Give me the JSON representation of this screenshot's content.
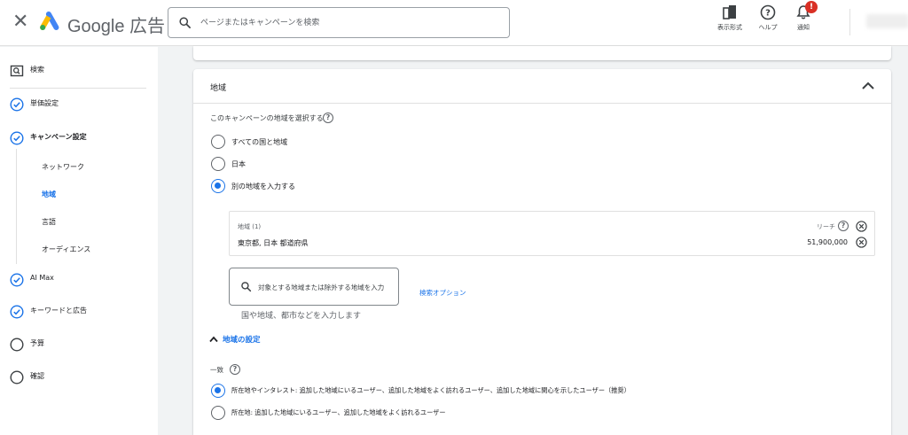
{
  "header": {
    "brand": "Google 広告",
    "search_placeholder": "ページまたはキャンペーンを検索",
    "tools": [
      {
        "label": "表示形式",
        "icon": "display-format-icon"
      },
      {
        "label": "ヘルプ",
        "icon": "help-icon"
      },
      {
        "label": "通知",
        "icon": "bell-icon",
        "badge": "!"
      }
    ]
  },
  "sidebar": {
    "search_label": "検索",
    "items": [
      {
        "label": "単価設定",
        "status": "done"
      },
      {
        "label": "キャンペーン設定",
        "status": "done"
      },
      {
        "label": "AI Max",
        "status": "done"
      },
      {
        "label": "キーワードと広告",
        "status": "done"
      },
      {
        "label": "予算",
        "status": "todo"
      },
      {
        "label": "確認",
        "status": "todo"
      }
    ],
    "subitems": [
      {
        "label": "ネットワーク"
      },
      {
        "label": "地域",
        "active": true
      },
      {
        "label": "言語"
      },
      {
        "label": "オーディエンス"
      }
    ]
  },
  "section": {
    "title": "地域",
    "question": "このキャンペーンの地域を選択する",
    "options": [
      {
        "label": "すべての国と地域",
        "selected": false
      },
      {
        "label": "日本",
        "selected": false
      },
      {
        "label": "別の地域を入力する",
        "selected": true
      }
    ],
    "locations_header": "地域 (1)",
    "reach_label": "リーチ",
    "location_name": "東京都, 日本 都道府県",
    "location_reach": "51,900,000",
    "input_placeholder": "対象とする地域または除外する地域を入力",
    "search_options": "検索オプション",
    "hint": "国や地域、都市などを入力します",
    "settings_label": "地域の設定",
    "match_label": "一致",
    "match_options": [
      {
        "label": "所在地やインタレスト: 追加した地域にいるユーザー、追加した地域をよく訪れるユーザー、追加した地域に関心を示したユーザー（推奨）",
        "selected": true
      },
      {
        "label": "所在地: 追加した地域にいるユーザー、追加した地域をよく訪れるユーザー",
        "selected": false
      }
    ]
  },
  "colors": {
    "accent": "#1a73e8",
    "badge": "#d93025",
    "background": "#f1f3f4"
  }
}
